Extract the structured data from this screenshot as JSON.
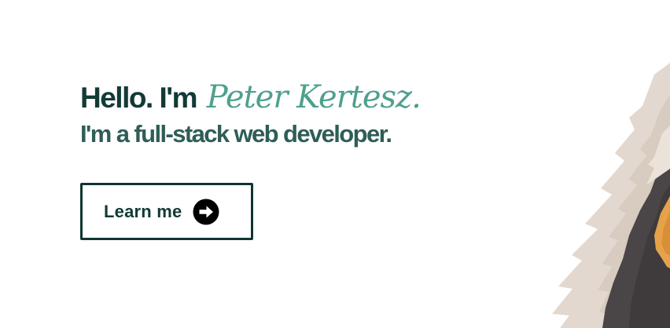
{
  "hero": {
    "greeting": "Hello. I'm",
    "name": "Peter Kertesz.",
    "tagline": "I'm a full-stack web developer."
  },
  "cta": {
    "label": "Learn me",
    "icon": "arrow-right-circle-icon"
  },
  "colors": {
    "heading": "#123a36",
    "accent_name": "#4ea08e",
    "subheading": "#2f5d57",
    "button_border": "#0f3531"
  },
  "illustration": {
    "icon": "portrait-illustration"
  }
}
